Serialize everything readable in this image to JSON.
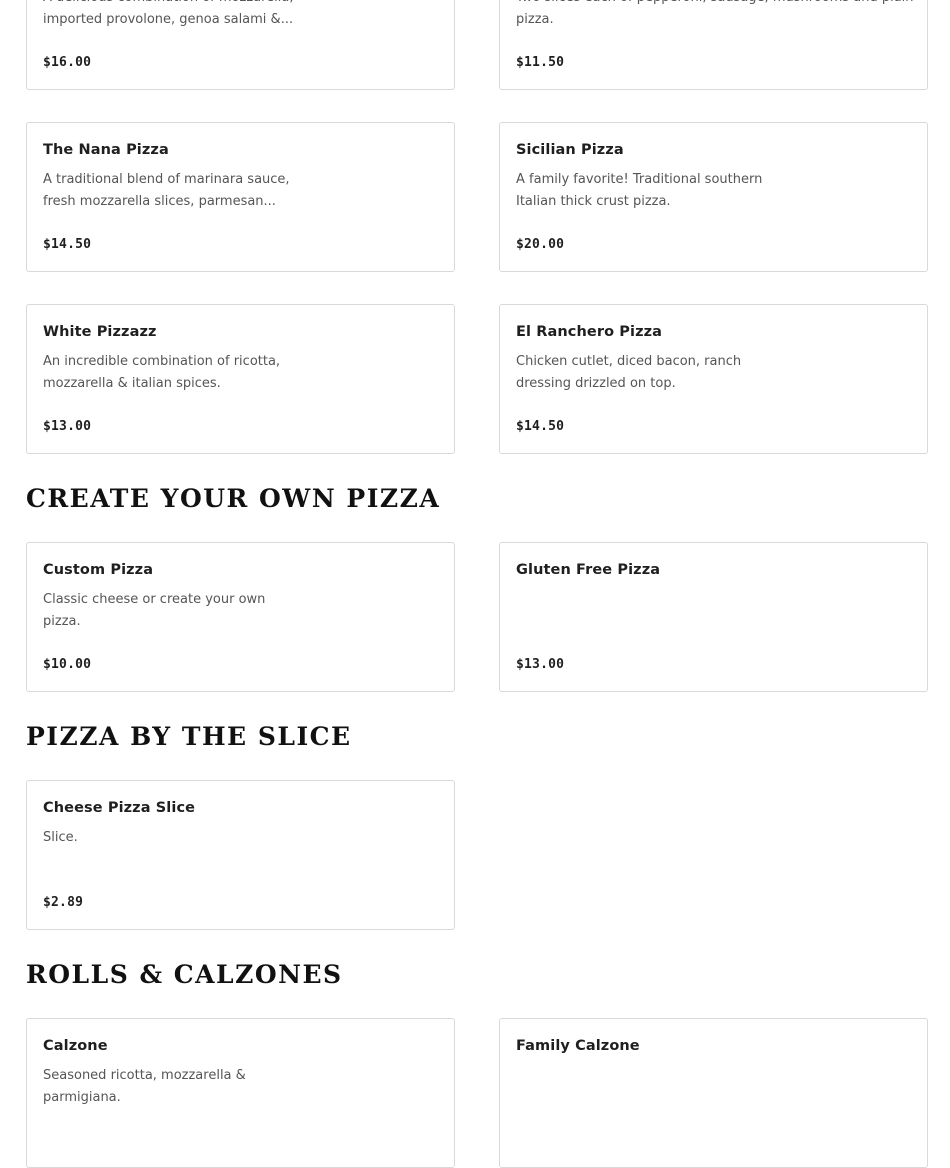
{
  "sections": [
    {
      "title": "",
      "items": [
        {
          "name": "",
          "desc_lines": [
            "A delicious combination of mozzarella,",
            "imported provolone, genoa salami &..."
          ],
          "price": "$16.00"
        },
        {
          "name": "",
          "desc_lines": [
            "Two slices each of pepperoni, sausage, mushrooms and plain",
            "pizza."
          ],
          "price": "$11.50"
        },
        {
          "name": "The Nana Pizza",
          "desc_lines": [
            "A traditional blend of marinara sauce,",
            "fresh mozzarella slices, parmesan..."
          ],
          "price": "$14.50"
        },
        {
          "name": "Sicilian Pizza",
          "desc_lines": [
            "A family favorite! Traditional southern",
            "Italian thick crust pizza."
          ],
          "price": "$20.00"
        },
        {
          "name": "White Pizzazz",
          "desc_lines": [
            "An incredible combination of ricotta,",
            "mozzarella & italian spices."
          ],
          "price": "$13.00"
        },
        {
          "name": "El Ranchero Pizza",
          "desc_lines": [
            "Chicken cutlet, diced bacon, ranch",
            "dressing drizzled on top."
          ],
          "price": "$14.50"
        }
      ]
    },
    {
      "title": "CREATE YOUR OWN PIZZA",
      "items": [
        {
          "name": "Custom Pizza",
          "desc_lines": [
            "Classic cheese or create your own",
            "pizza."
          ],
          "price": "$10.00"
        },
        {
          "name": "Gluten Free Pizza",
          "desc_lines": [],
          "price": "$13.00"
        }
      ]
    },
    {
      "title": "PIZZA BY THE SLICE",
      "items": [
        {
          "name": "Cheese Pizza Slice",
          "desc_lines": [
            "Slice."
          ],
          "price": "$2.89"
        }
      ]
    },
    {
      "title": "ROLLS & CALZONES",
      "items": [
        {
          "name": "Calzone",
          "desc_lines": [
            "Seasoned ricotta, mozzarella &",
            "parmigiana."
          ],
          "price": ""
        },
        {
          "name": "Family Calzone",
          "desc_lines": [],
          "price": ""
        }
      ]
    }
  ]
}
